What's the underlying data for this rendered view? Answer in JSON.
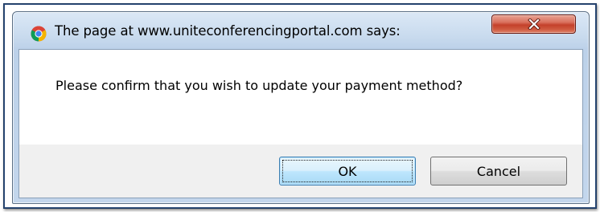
{
  "dialog": {
    "title": "The page at www.uniteconferencingportal.com says:",
    "title_icon": "chrome-icon",
    "close_icon": "close-icon",
    "message": "Please confirm that you wish to update your payment method?",
    "buttons": {
      "ok_label": "OK",
      "cancel_label": "Cancel"
    }
  },
  "colors": {
    "titlebar": "#c9dbee",
    "close_button": "#c4402b",
    "focus_button_border": "#3c7fb1",
    "button_area": "#f0f0f0"
  }
}
